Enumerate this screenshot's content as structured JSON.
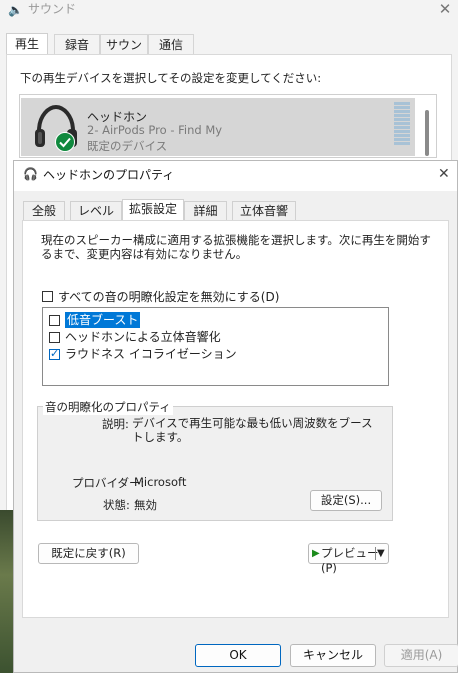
{
  "sound_window": {
    "title": "サウンド",
    "icon": "speaker-icon",
    "close_glyph": "✕",
    "tabs": [
      {
        "label": "再生",
        "active": true
      },
      {
        "label": "録音",
        "active": false
      },
      {
        "label": "サウンド",
        "active": false
      },
      {
        "label": "通信",
        "active": false
      }
    ],
    "instruction": "下の再生デバイスを選択してその設定を変更してください:",
    "device": {
      "name": "ヘッドホン",
      "subtitle": "2- AirPods Pro - Find My",
      "status": "既定のデバイス",
      "icon": "headphones-icon",
      "badge_icon": "check-badge-icon"
    }
  },
  "properties_dialog": {
    "title": "ヘッドホンのプロパティ",
    "icon": "headphones-icon",
    "close_glyph": "✕",
    "tabs": [
      {
        "label": "全般",
        "active": false
      },
      {
        "label": "レベル",
        "active": false
      },
      {
        "label": "拡張設定",
        "active": true
      },
      {
        "label": "詳細",
        "active": false
      },
      {
        "label": "立体音響",
        "active": false
      }
    ],
    "description": "現在のスピーカー構成に適用する拡張機能を選択します。次に再生を開始するまで、変更内容は有効になりません。",
    "disable_all": {
      "label": "すべての音の明瞭化設定を無効にする(D)",
      "checked": false
    },
    "enhancements": [
      {
        "label": "低音ブースト",
        "checked": false,
        "selected": true
      },
      {
        "label": "ヘッドホンによる立体音響化",
        "checked": false,
        "selected": false
      },
      {
        "label": "ラウドネス イコライゼーション",
        "checked": true,
        "selected": false
      }
    ],
    "group": {
      "title": "音の明瞭化のプロパティ",
      "description_label": "説明:",
      "description_value": "デバイスで再生可能な最も低い周波数をブーストします。",
      "provider_label": "プロバイダー:",
      "provider_value": "Microsoft",
      "status_label": "状態:",
      "status_value": "無効",
      "settings_button": "設定(S)..."
    },
    "restore_button": "既定に戻す(R)",
    "preview_button": "プレビュー(P)",
    "footer": {
      "ok": "OK",
      "cancel": "キャンセル",
      "apply": "適用(A)"
    }
  }
}
